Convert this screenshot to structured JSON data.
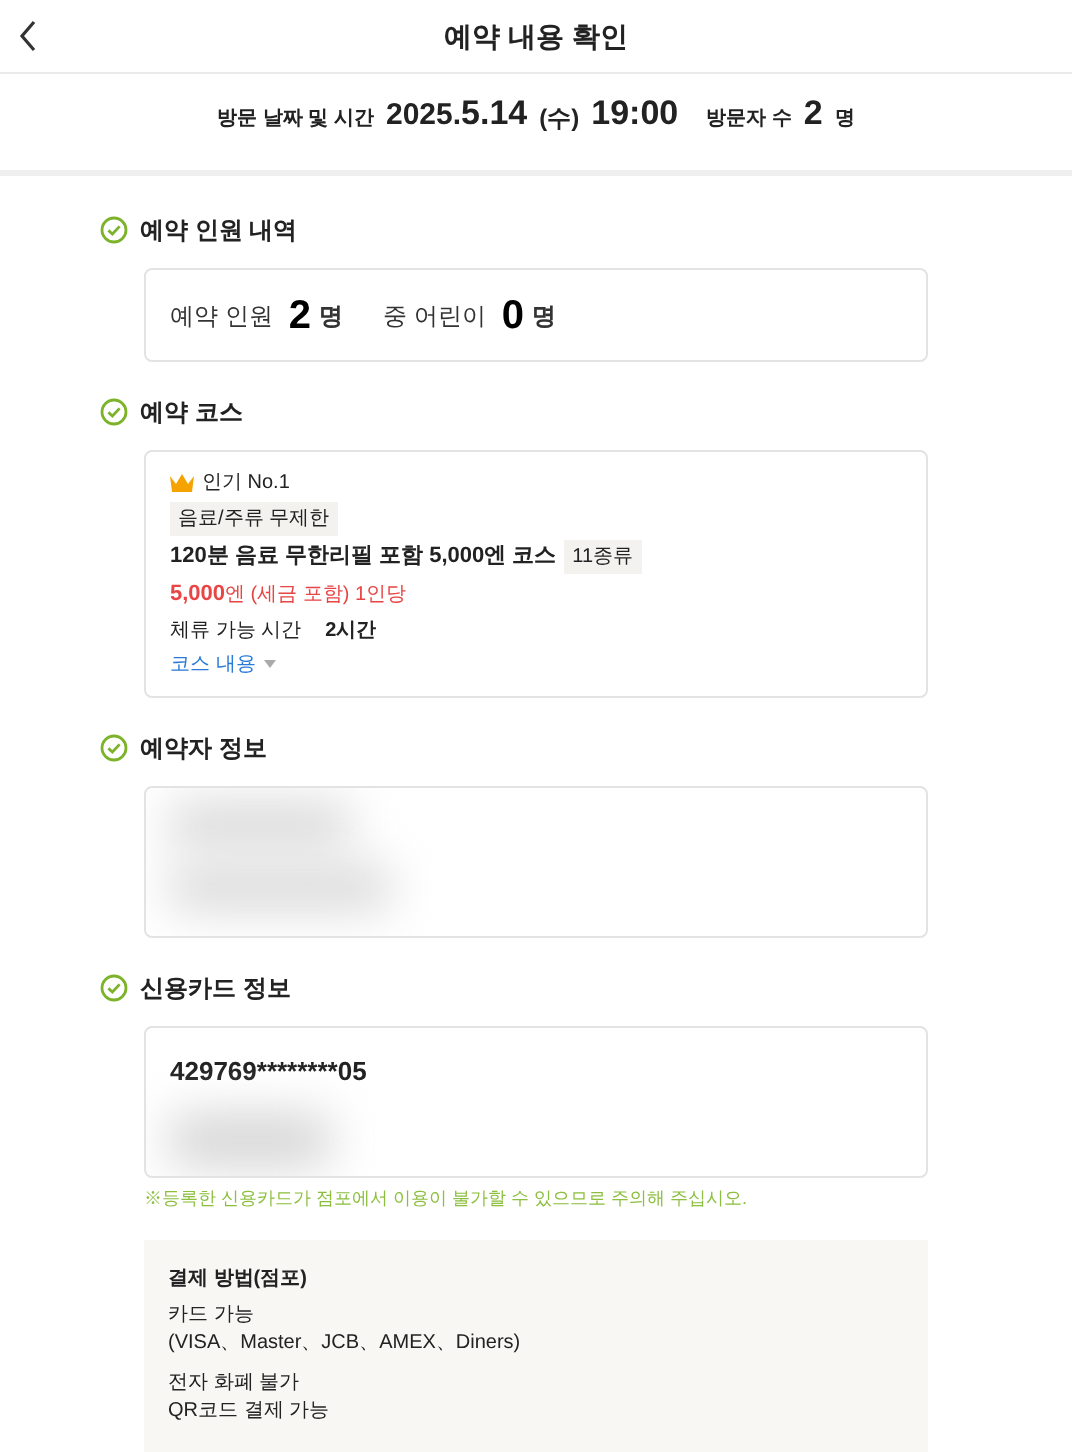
{
  "header": {
    "title": "예약 내용 확인"
  },
  "visit": {
    "label": "방문 날짜 및 시간",
    "year": "2025.",
    "date": "5.14",
    "weekday": "(수)",
    "time": "19:00",
    "visitors_label": "방문자 수",
    "visitors_count": "2",
    "visitors_unit": "명"
  },
  "sections": [
    {
      "kind": "party",
      "title": "예약 인원 내역",
      "label": "예약 인원",
      "count": "2",
      "unit": "명",
      "child_label": "중 어린이",
      "child_count": "0",
      "child_unit": "명"
    },
    {
      "kind": "course",
      "title": "예약 코스",
      "rank": "인기 No.1",
      "tag": "음료/주류 무제한",
      "name": "120분 음료 무한리필 포함 5,000엔 코스",
      "variety": "11종류",
      "price": "5,000",
      "price_rest": "엔 (세금 포함) 1인당",
      "stay_label": "체류 가능 시간",
      "stay_value": "2시간",
      "details_link": "코스 내용"
    },
    {
      "kind": "booker",
      "title": "예약자 정보"
    },
    {
      "kind": "card",
      "title": "신용카드 정보",
      "card_number": "429769********05",
      "note": "※등록한 신용카드가 점포에서 이용이 불가할 수 있으므로 주의해 주십시오."
    }
  ],
  "payment": {
    "title": "결제 방법(점포)",
    "groups": [
      [
        "카드 가능",
        "(VISA、Master、JCB、AMEX、Diners)"
      ],
      [
        "전자 화폐 불가",
        "QR코드 결제 가능"
      ]
    ]
  }
}
